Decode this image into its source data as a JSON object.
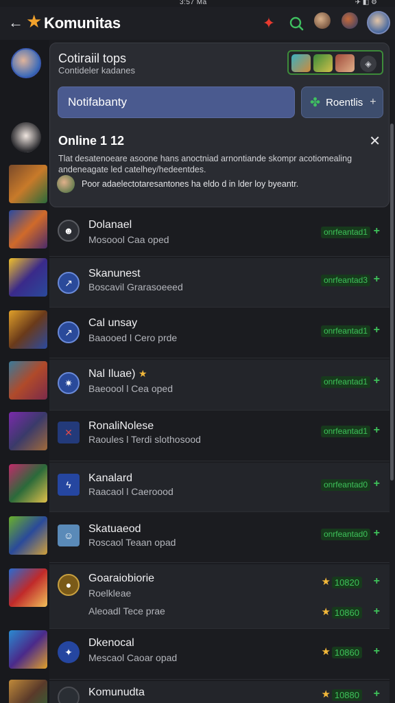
{
  "status": {
    "time": "3:57 Ma",
    "icons": "✈ ◧ ⚙"
  },
  "header": {
    "title": "Komunitas",
    "back_icon": "arrow-left-icon",
    "brand_icon": "star-icon",
    "accent": "#f2a22c"
  },
  "card": {
    "title": "Cotiraiil tops",
    "subtitle": "Contideler kadanes",
    "primary_button": "Notifabanty",
    "secondary_button": "Roentlis",
    "online_title": "Online 1 12",
    "online_desc": "Tlat desatenoeare asoone hans anoctniad arnontiande skompr acotiomealing andeneagate led catelhey/hedeentdes.",
    "online_note": "Poor adaelectotaresantones ha eldo d in lder loy byeantr."
  },
  "list": [
    {
      "name": "Dolanael",
      "desc": "Mosoool Caa oped",
      "badge": "onrfeantad1",
      "plus": "+",
      "icon_color": "#2c2e34"
    },
    {
      "name": "Skanunest",
      "desc": "Boscavil Grarasoeeed",
      "badge": "onrfeantad3",
      "plus": "+",
      "icon_color": "#2a4a9a"
    },
    {
      "name": "Cal unsay",
      "desc": "Baaooed l Cero prde",
      "badge": "onrfeantad1",
      "plus": "+",
      "icon_color": "#2a4a9a"
    },
    {
      "name": "Nal Iluae)",
      "desc": "Baeoool l Cea oped",
      "badge": "onrfeantad1",
      "plus": "+",
      "icon_color": "#2a4a9a",
      "star": "★"
    },
    {
      "name": "RonaliNolese",
      "desc": "Raoules l Terdi slothosood",
      "badge": "onrfeantad1",
      "plus": "+",
      "icon_color": "#233a7a"
    },
    {
      "name": "Kanalard",
      "desc": "Raacaol l Caeroood",
      "badge": "onrfeantad0",
      "plus": "+",
      "icon_color": "#2546a0"
    },
    {
      "name": "Skatuaeod",
      "desc": "Roscaol Teaan opad",
      "badge": "onrfeantad0",
      "plus": "+",
      "icon_color": "#5a8ab8"
    },
    {
      "name": "Goaraiobiorie",
      "desc": "Roelkleae",
      "desc2": "Aleoadl Tece prae",
      "score": "10820",
      "score2": "10860",
      "plus": "+",
      "icon_color": "#7a5a18"
    },
    {
      "name": "Dkenocal",
      "desc": "Mescaol Caoar opad",
      "score": "10860",
      "plus": "+",
      "icon_color": "#2546a0"
    },
    {
      "name": "Komunudta",
      "desc": "",
      "score": "10880",
      "plus": "+",
      "icon_color": "#2a2e34"
    }
  ]
}
